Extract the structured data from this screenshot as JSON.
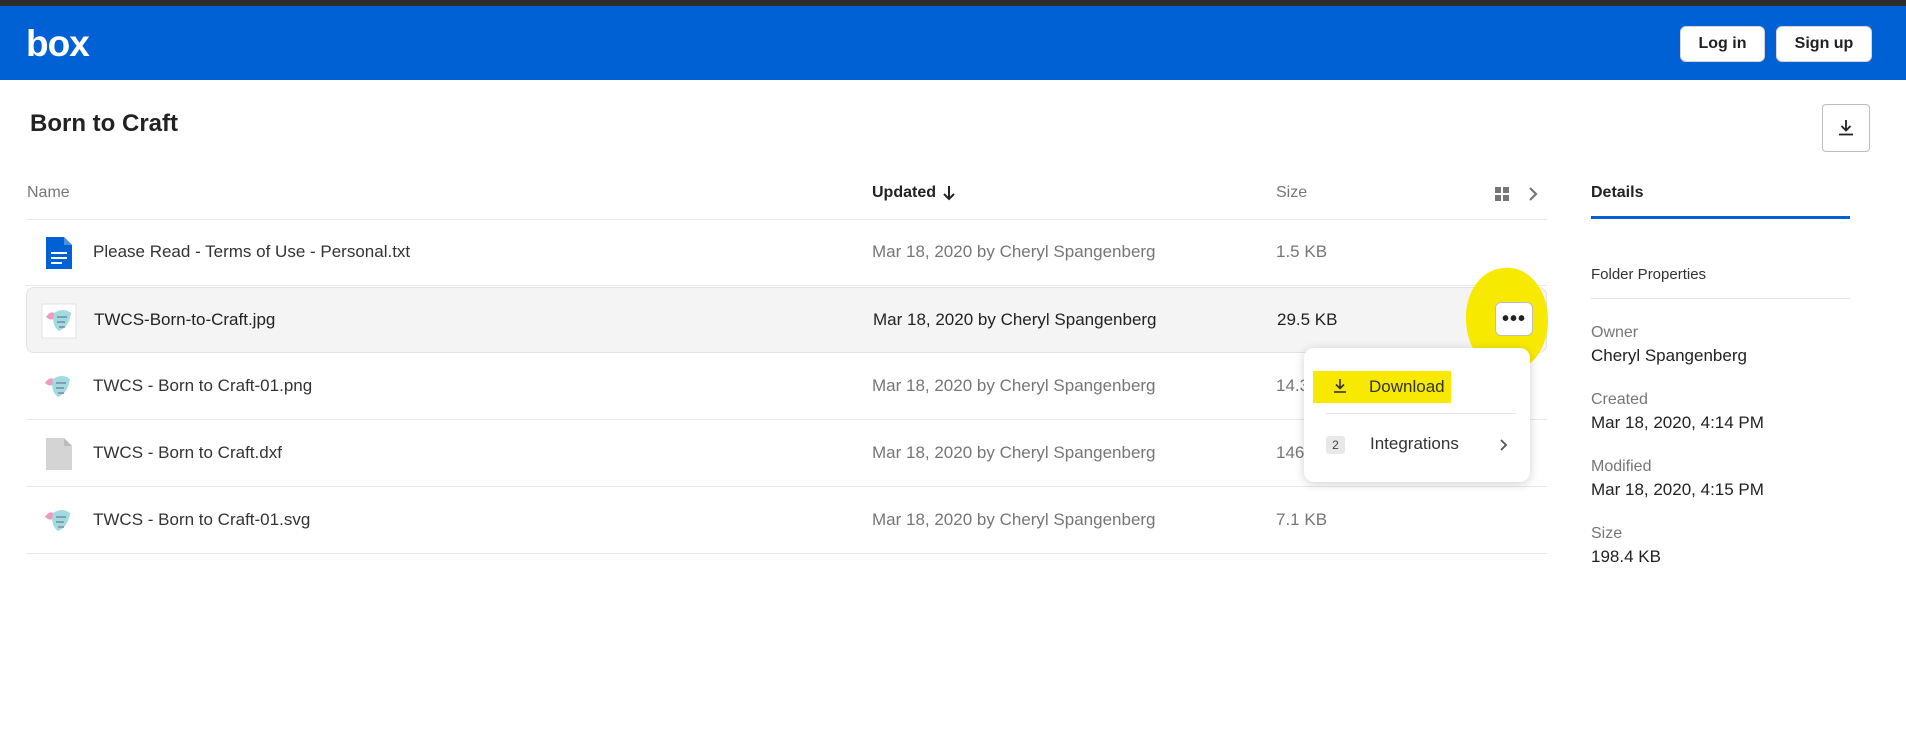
{
  "header": {
    "logo": "box",
    "login_label": "Log in",
    "signup_label": "Sign up",
    "brand_color": "#0061d5"
  },
  "folder": {
    "title": "Born to Craft"
  },
  "columns": {
    "name": "Name",
    "updated": "Updated",
    "size": "Size"
  },
  "files": [
    {
      "name": "Please Read - Terms of Use - Personal.txt",
      "updated": "Mar 18, 2020 by Cheryl Spangenberg",
      "size": "1.5 KB",
      "icon": "text-file-icon"
    },
    {
      "name": "TWCS-Born-to-Craft.jpg",
      "updated": "Mar 18, 2020 by Cheryl Spangenberg",
      "size": "29.5 KB",
      "icon": "image-thumbnail-icon"
    },
    {
      "name": "TWCS - Born to Craft-01.png",
      "updated": "Mar 18, 2020 by Cheryl Spangenberg",
      "size": "14.3",
      "icon": "image-thumbnail-icon"
    },
    {
      "name": "TWCS - Born to Craft.dxf",
      "updated": "Mar 18, 2020 by Cheryl Spangenberg",
      "size": "146",
      "icon": "generic-file-icon"
    },
    {
      "name": "TWCS - Born to Craft-01.svg",
      "updated": "Mar 18, 2020 by Cheryl Spangenberg",
      "size": "7.1 KB",
      "icon": "image-thumbnail-icon"
    }
  ],
  "context_menu": {
    "download_label": "Download",
    "integrations_label": "Integrations",
    "integrations_count": "2"
  },
  "details": {
    "tab_label": "Details",
    "section_title": "Folder Properties",
    "owner_label": "Owner",
    "owner_value": "Cheryl Spangenberg",
    "created_label": "Created",
    "created_value": "Mar 18, 2020, 4:14 PM",
    "modified_label": "Modified",
    "modified_value": "Mar 18, 2020, 4:15 PM",
    "size_label": "Size",
    "size_value": "198.4 KB"
  },
  "highlight_color": "#f7ea00"
}
